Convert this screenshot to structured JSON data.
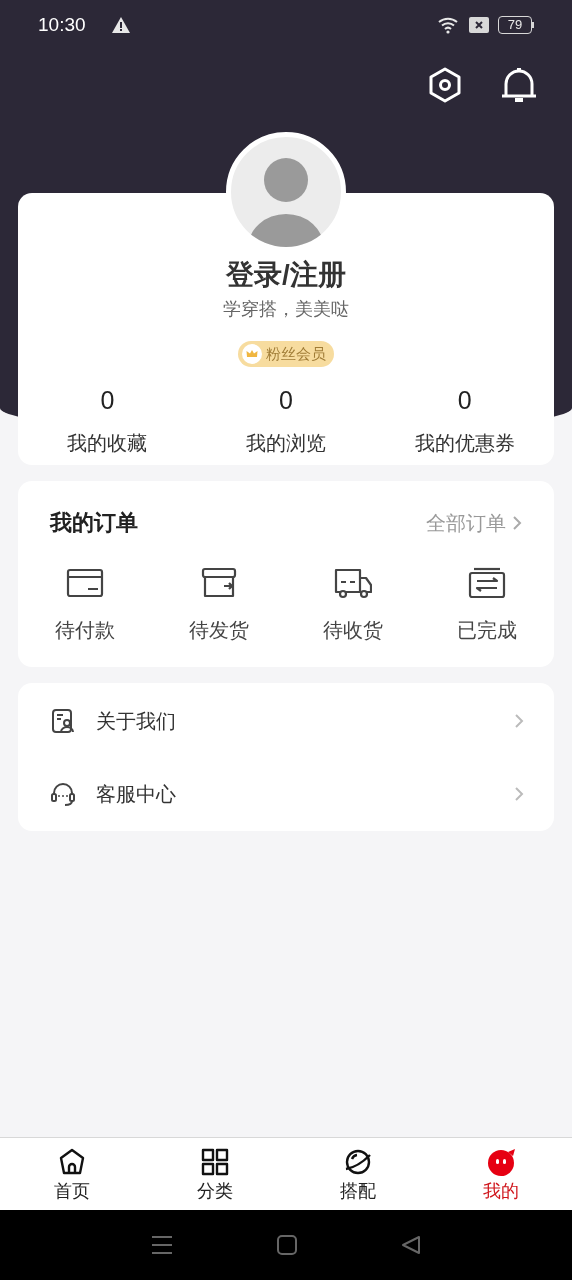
{
  "status_bar": {
    "time": "10:30",
    "battery": "79"
  },
  "profile": {
    "title": "登录/注册",
    "subtitle": "学穿搭，美美哒",
    "badge": "粉丝会员"
  },
  "stats": [
    {
      "value": "0",
      "label": "我的收藏"
    },
    {
      "value": "0",
      "label": "我的浏览"
    },
    {
      "value": "0",
      "label": "我的优惠券"
    }
  ],
  "orders": {
    "title": "我的订单",
    "link": "全部订单",
    "items": [
      {
        "kind": "pay",
        "label": "待付款"
      },
      {
        "kind": "ship",
        "label": "待发货"
      },
      {
        "kind": "receive",
        "label": "待收货"
      },
      {
        "kind": "done",
        "label": "已完成"
      }
    ]
  },
  "menu": [
    {
      "kind": "about",
      "label": "关于我们"
    },
    {
      "kind": "service",
      "label": "客服中心"
    }
  ],
  "tabs": [
    {
      "kind": "home",
      "label": "首页",
      "selected": false
    },
    {
      "kind": "category",
      "label": "分类",
      "selected": false
    },
    {
      "kind": "match",
      "label": "搭配",
      "selected": false
    },
    {
      "kind": "mine",
      "label": "我的",
      "selected": true
    }
  ]
}
